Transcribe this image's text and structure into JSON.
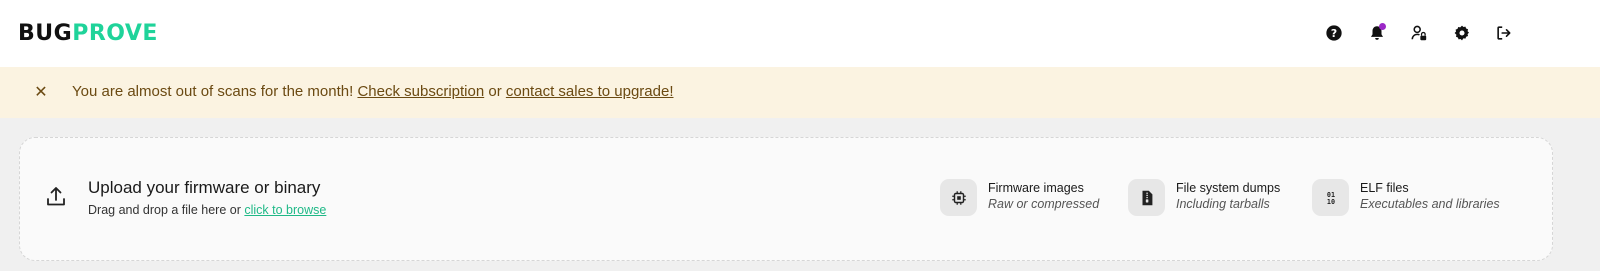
{
  "header": {
    "logo": {
      "part1": "BUG",
      "part2": "PROVE"
    },
    "icons": [
      "help-icon",
      "bell-icon",
      "user-lock-icon",
      "gear-icon",
      "logout-icon"
    ],
    "colors": {
      "brand_green": "#1fd39a",
      "notification_dot": "#9b27c7"
    }
  },
  "banner": {
    "close_symbol": "✕",
    "message": "You are almost out of scans for the month!",
    "link1": "Check subscription",
    "connector": "or",
    "link2": "contact sales to upgrade!",
    "colors": {
      "background": "#fbf3e1",
      "text": "#6b4a12"
    }
  },
  "upload": {
    "title": "Upload your firmware or binary",
    "subtitle_prefix": "Drag and drop a file here or",
    "browse_link": "click to browse",
    "file_types": [
      {
        "title": "Firmware images",
        "desc": "Raw or compressed",
        "icon": "chip-icon"
      },
      {
        "title": "File system dumps",
        "desc": "Including tarballs",
        "icon": "archive-file-icon"
      },
      {
        "title": "ELF files",
        "desc": "Executables and libraries",
        "icon": "binary-icon"
      }
    ]
  }
}
